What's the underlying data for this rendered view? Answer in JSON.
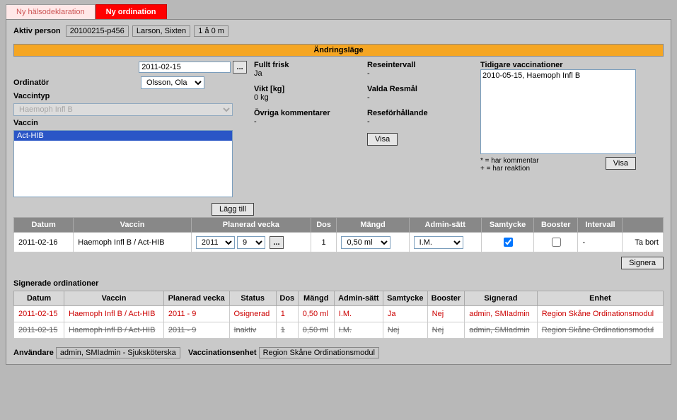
{
  "tabs": {
    "health": "Ny hälsodeklaration",
    "ordination": "Ny ordination"
  },
  "person": {
    "label": "Aktiv person",
    "id": "20100215-p456",
    "name": "Larson, Sixten",
    "age": "1 å 0 m"
  },
  "modeBanner": "Ändringsläge",
  "form": {
    "date": "2011-02-15",
    "ordinatorLabel": "Ordinatör",
    "ordinator": "Olsson, Ola",
    "vaccineTypeLabel": "Vaccintyp",
    "vaccineType": "Haemoph Infl B",
    "vaccineLabel": "Vaccin",
    "vaccineSelected": "Act-HIB"
  },
  "info": {
    "fulltFriskLabel": "Fullt frisk",
    "fulltFrisk": "Ja",
    "viktLabel": "Vikt [kg]",
    "vikt": "0 kg",
    "ovrigaLabel": "Övriga kommentarer",
    "ovriga": "-",
    "reseintervalLabel": "Reseintervall",
    "reseinterval": "-",
    "valdaResmalLabel": "Valda Resmål",
    "valdaResmal": "-",
    "reseforhLabel": "Reseförhållande",
    "reseforh": "-",
    "visaBtn": "Visa"
  },
  "previous": {
    "label": "Tidigare vaccinationer",
    "text": "2010-05-15, Haemoph Infl B",
    "legend1": "* = har kommentar",
    "legend2": "+ = har reaktion",
    "visaBtn": "Visa"
  },
  "addBtn": "Lägg till",
  "grid": {
    "headers": {
      "datum": "Datum",
      "vaccin": "Vaccin",
      "planerad": "Planerad vecka",
      "dos": "Dos",
      "mangd": "Mängd",
      "admin": "Admin-sätt",
      "samtycke": "Samtycke",
      "booster": "Booster",
      "intervall": "Intervall",
      "last": ""
    },
    "row": {
      "datum": "2011-02-16",
      "vaccin": "Haemoph Infl B / Act-HIB",
      "year": "2011",
      "week": "9",
      "dos": "1",
      "mangd": "0,50 ml",
      "admin": "I.M.",
      "intervall": "-",
      "tabort": "Ta bort"
    }
  },
  "signera": "Signera",
  "signed": {
    "title": "Signerade ordinationer",
    "headers": {
      "datum": "Datum",
      "vaccin": "Vaccin",
      "planerad": "Planerad vecka",
      "status": "Status",
      "dos": "Dos",
      "mangd": "Mängd",
      "admin": "Admin-sätt",
      "samtycke": "Samtycke",
      "booster": "Booster",
      "signerad": "Signerad",
      "enhet": "Enhet"
    },
    "rows": [
      {
        "datum": "2011-02-15",
        "vaccin": "Haemoph Infl B / Act-HIB",
        "planerad": "2011 - 9",
        "status": "Osignerad",
        "dos": "1",
        "mangd": "0,50 ml",
        "admin": "I.M.",
        "samtycke": "Ja",
        "booster": "Nej",
        "signerad": "admin, SMIadmin",
        "enhet": "Region Skåne Ordinationsmodul"
      },
      {
        "datum": "2011-02-15",
        "vaccin": "Haemoph Infl B / Act-HIB",
        "planerad": "2011 - 9",
        "status": "Inaktiv",
        "dos": "1",
        "mangd": "0,50 ml",
        "admin": "I.M.",
        "samtycke": "Nej",
        "booster": "Nej",
        "signerad": "admin, SMIadmin",
        "enhet": "Region Skåne Ordinationsmodul"
      }
    ]
  },
  "footer": {
    "userLabel": "Användare",
    "user": "admin, SMIadmin - Sjuksköterska",
    "unitLabel": "Vaccinationsenhet",
    "unit": "Region Skåne Ordinationsmodul"
  }
}
